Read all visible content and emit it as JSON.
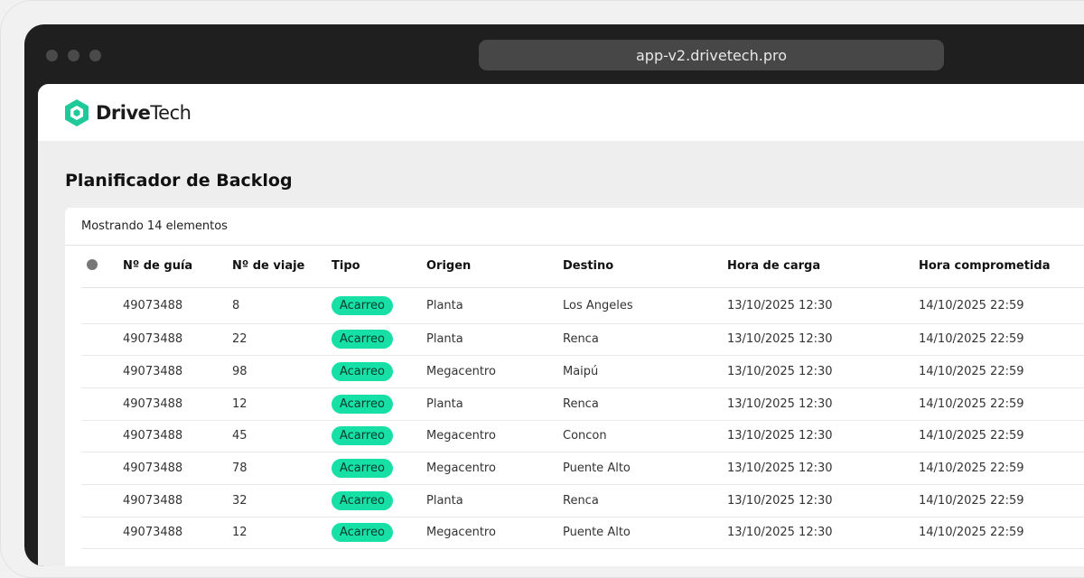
{
  "browser": {
    "url": "app-v2.drivetech.pro"
  },
  "brand": {
    "bold": "Drive",
    "light": "Tech",
    "color": "#1fc99a"
  },
  "page": {
    "title": "Planificador de Backlog",
    "count": "Mostrando 14 elementos"
  },
  "table": {
    "headers": [
      "Nº de guía",
      "Nº de viaje",
      "Tipo",
      "Origen",
      "Destino",
      "Hora de carga",
      "Hora comprometida"
    ],
    "rows": [
      [
        "49073488",
        "8",
        "Acarreo",
        "Planta",
        "Los Angeles",
        "13/10/2025 12:30",
        "14/10/2025 22:59"
      ],
      [
        "49073488",
        "22",
        "Acarreo",
        "Planta",
        "Renca",
        "13/10/2025 12:30",
        "14/10/2025 22:59"
      ],
      [
        "49073488",
        "98",
        "Acarreo",
        "Megacentro",
        "Maipú",
        "13/10/2025 12:30",
        "14/10/2025 22:59"
      ],
      [
        "49073488",
        "12",
        "Acarreo",
        "Planta",
        "Renca",
        "13/10/2025 12:30",
        "14/10/2025 22:59"
      ],
      [
        "49073488",
        "45",
        "Acarreo",
        "Megacentro",
        "Concon",
        "13/10/2025 12:30",
        "14/10/2025 22:59"
      ],
      [
        "49073488",
        "78",
        "Acarreo",
        "Megacentro",
        "Puente Alto",
        "13/10/2025 12:30",
        "14/10/2025 22:59"
      ],
      [
        "49073488",
        "32",
        "Acarreo",
        "Planta",
        "Renca",
        "13/10/2025 12:30",
        "14/10/2025 22:59"
      ],
      [
        "49073488",
        "12",
        "Acarreo",
        "Megacentro",
        "Puente Alto",
        "13/10/2025 12:30",
        "14/10/2025 22:59"
      ]
    ]
  }
}
